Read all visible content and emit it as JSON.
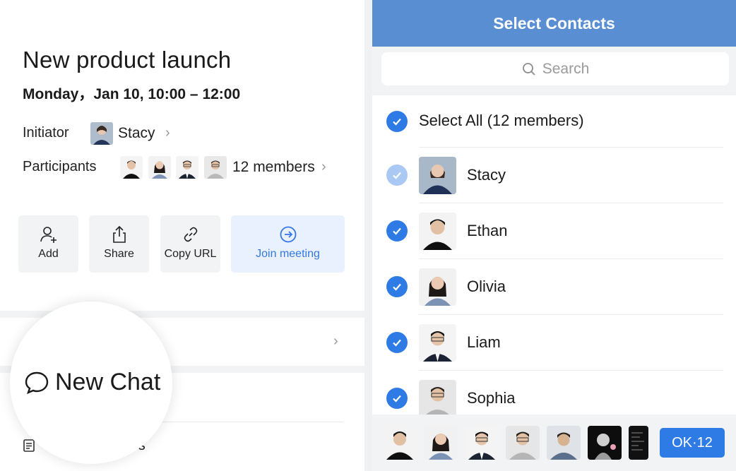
{
  "event": {
    "title": "New product launch",
    "datetime": "Monday，Jan 10, 10:00 – 12:00",
    "initiator_label": "Initiator",
    "initiator_name": "Stacy",
    "participants_label": "Participants",
    "participants_count": "12 members"
  },
  "actions": {
    "add": "Add",
    "share": "Share",
    "copy_url": "Copy URL",
    "join": "Join meeting"
  },
  "bubble": {
    "new_chat": "New Chat"
  },
  "minutes": {
    "label": "utes"
  },
  "contacts_panel": {
    "title": "Select Contacts",
    "search_placeholder": "Search",
    "select_all": "Select All (12 members)",
    "contacts": [
      {
        "name": "Stacy",
        "checked": "disabled"
      },
      {
        "name": "Ethan",
        "checked": "checked"
      },
      {
        "name": "Olivia",
        "checked": "checked"
      },
      {
        "name": "Liam",
        "checked": "checked"
      },
      {
        "name": "Sophia",
        "checked": "checked"
      }
    ],
    "ok_button": "OK·12"
  },
  "colors": {
    "accent": "#2f7be5",
    "header": "#5a8ed3",
    "join_bg": "#e8f1fd",
    "panel_bg": "#f2f3f5"
  }
}
